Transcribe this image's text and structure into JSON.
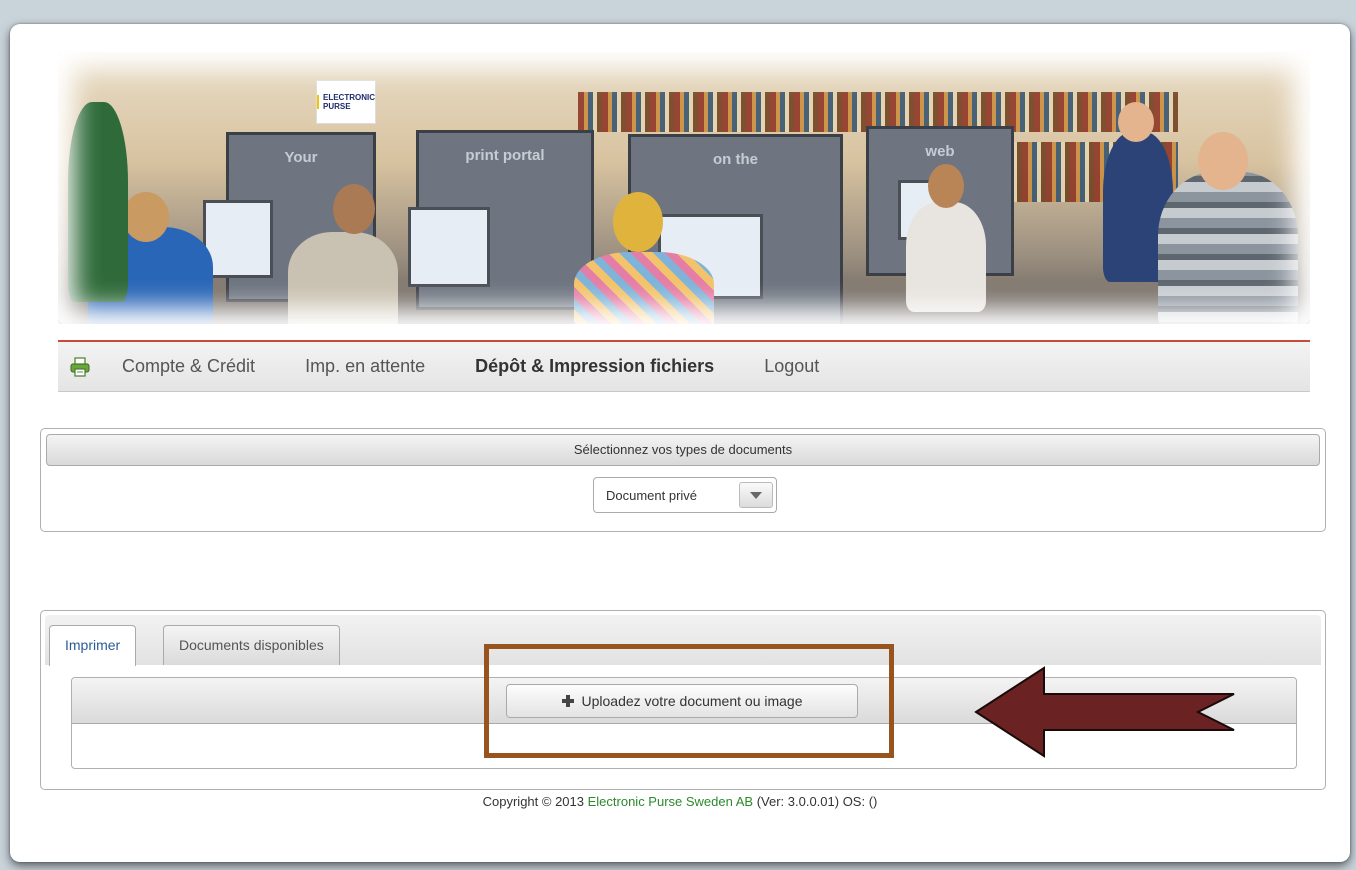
{
  "banner": {
    "panel_texts": [
      "Your",
      "print portal",
      "on the",
      "web"
    ],
    "logo_text": "ELECTRONIC PURSE"
  },
  "nav": {
    "icon": "printer-icon",
    "items": [
      {
        "label": "Compte & Crédit",
        "active": false
      },
      {
        "label": "Imp. en attente",
        "active": false
      },
      {
        "label": "Dépôt & Impression fichiers",
        "active": true
      },
      {
        "label": "Logout",
        "active": false
      }
    ]
  },
  "doctype": {
    "header": "Sélectionnez vos types de documents",
    "selected": "Document privé",
    "icon": "chevron-down-icon"
  },
  "tabs": {
    "items": [
      {
        "label": "Imprimer",
        "active": true
      },
      {
        "label": "Documents disponibles",
        "active": false
      }
    ]
  },
  "upload": {
    "button_label": "Uploadez votre document ou image",
    "icon": "plus-icon"
  },
  "annotations": {
    "highlight_color": "#98541f",
    "arrow_color": "#6b2222"
  },
  "footer": {
    "prefix": "Copyright © 2013 ",
    "company": "Electronic Purse Sweden AB",
    "suffix": " (Ver: 3.0.0.01) OS: ()"
  }
}
